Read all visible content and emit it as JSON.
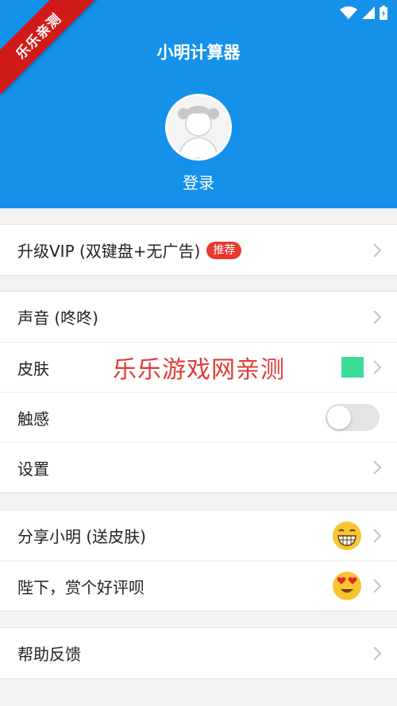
{
  "header": {
    "title": "小明计算器",
    "login_label": "登录",
    "ribbon_text": "乐乐亲测",
    "back_icon": "back-arrow-icon"
  },
  "groups": {
    "vip": {
      "label": "升级VIP (双键盘+无广告)",
      "badge": "推荐"
    },
    "settings": {
      "sound_label": "声音 (咚咚)",
      "skin_label": "皮肤",
      "skin_color": "#3ddc97",
      "haptic_label": "触感",
      "haptic_on": false,
      "settings_label": "设置"
    },
    "share": {
      "share_label": "分享小明 (送皮肤)",
      "rate_label": "陛下，赏个好评呗"
    },
    "help": {
      "help_label": "帮助反馈"
    }
  },
  "watermark": "乐乐游戏网亲测",
  "colors": {
    "header": "#1591ea",
    "badge": "#e8392f",
    "ribbon": "#d11a1a"
  }
}
